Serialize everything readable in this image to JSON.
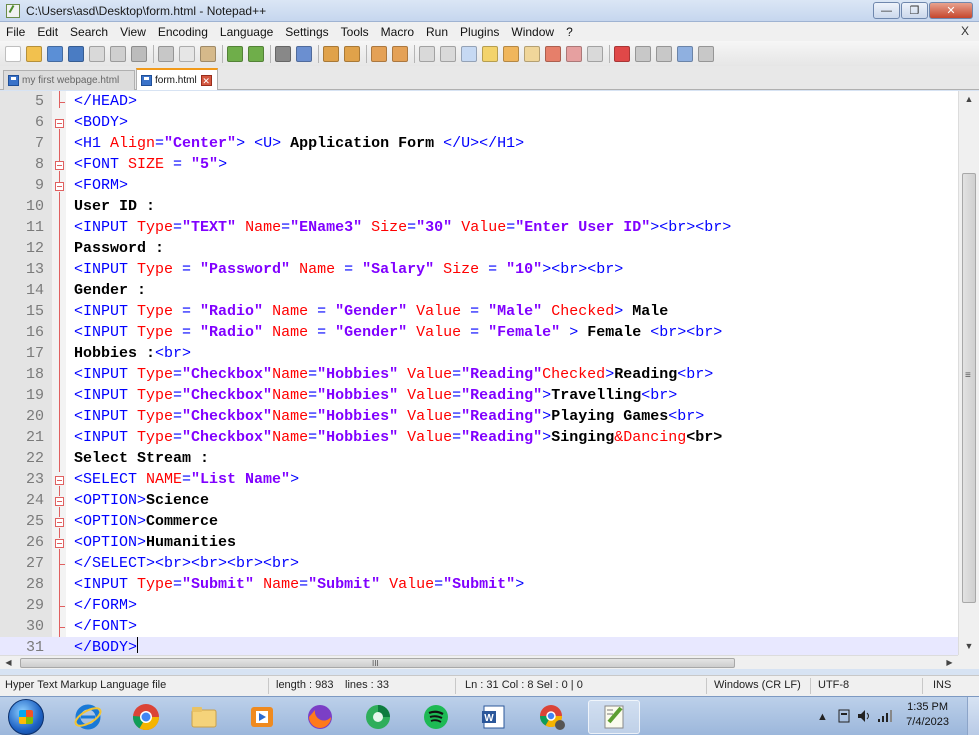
{
  "window": {
    "title": "C:\\Users\\asd\\Desktop\\form.html - Notepad++",
    "minimize": "—",
    "maximize": "❐",
    "close": "✕"
  },
  "menu": {
    "items": [
      "File",
      "Edit",
      "Search",
      "View",
      "Encoding",
      "Language",
      "Settings",
      "Tools",
      "Macro",
      "Run",
      "Plugins",
      "Window",
      "?"
    ],
    "close": "X"
  },
  "toolbar": {
    "icons": [
      "new-file-icon",
      "open-file-icon",
      "save-icon",
      "save-all-icon",
      "close-icon",
      "close-all-icon",
      "print-icon",
      "cut-icon",
      "copy-icon",
      "paste-icon",
      "undo-icon",
      "redo-icon",
      "find-icon",
      "replace-icon",
      "zoom-in-icon",
      "zoom-out-icon",
      "sync-vertical-icon",
      "sync-horizontal-icon",
      "word-wrap-icon",
      "show-all-chars-icon",
      "indent-guide-icon",
      "udl-icon",
      "doc-map-icon",
      "function-list-icon",
      "folder-workspace-icon",
      "monitoring-icon",
      "record-macro-icon",
      "stop-macro-icon",
      "play-macro-icon",
      "run-macro-multiple-icon",
      "save-macro-icon"
    ]
  },
  "tabs": [
    {
      "label": "my first webpage.html",
      "active": false
    },
    {
      "label": "form.html",
      "active": true
    }
  ],
  "editor": {
    "current_line": 31,
    "lines": [
      {
        "n": "5",
        "parts": [
          [
            "tg",
            "</HEAD>"
          ]
        ]
      },
      {
        "n": "6",
        "parts": [
          [
            "tg",
            "<BODY>"
          ]
        ]
      },
      {
        "n": "7",
        "parts": [
          [
            "tg",
            "<H1 "
          ],
          [
            "at",
            "Align"
          ],
          [
            "tg",
            "="
          ],
          [
            "st",
            "\"Center\""
          ],
          [
            "tg",
            "> <U> "
          ],
          [
            "tx",
            "Application Form "
          ],
          [
            "tg",
            "</U></H1>"
          ]
        ]
      },
      {
        "n": "8",
        "parts": [
          [
            "tg",
            "<FONT "
          ],
          [
            "at",
            "SIZE"
          ],
          [
            "tg",
            " = "
          ],
          [
            "st",
            "\"5\""
          ],
          [
            "tg",
            ">"
          ]
        ]
      },
      {
        "n": "9",
        "parts": [
          [
            "tg",
            "<FORM>"
          ]
        ]
      },
      {
        "n": "10",
        "parts": [
          [
            "tx",
            "User ID :"
          ]
        ]
      },
      {
        "n": "11",
        "parts": [
          [
            "tg",
            "<INPUT "
          ],
          [
            "at",
            "Type"
          ],
          [
            "tg",
            "="
          ],
          [
            "st",
            "\"TEXT\""
          ],
          [
            "tg",
            " "
          ],
          [
            "at",
            "Name"
          ],
          [
            "tg",
            "="
          ],
          [
            "st",
            "\"EName3\""
          ],
          [
            "tg",
            " "
          ],
          [
            "at",
            "Size"
          ],
          [
            "tg",
            "="
          ],
          [
            "st",
            "\"30\""
          ],
          [
            "tg",
            " "
          ],
          [
            "at",
            "Value"
          ],
          [
            "tg",
            "="
          ],
          [
            "st",
            "\"Enter User ID\""
          ],
          [
            "tg",
            "><br><br>"
          ]
        ]
      },
      {
        "n": "12",
        "parts": [
          [
            "tx",
            "Password :"
          ]
        ]
      },
      {
        "n": "13",
        "parts": [
          [
            "tg",
            "<INPUT "
          ],
          [
            "at",
            "Type"
          ],
          [
            "tg",
            " = "
          ],
          [
            "st",
            "\"Password\""
          ],
          [
            "tg",
            " "
          ],
          [
            "at",
            "Name"
          ],
          [
            "tg",
            " = "
          ],
          [
            "st",
            "\"Salary\""
          ],
          [
            "tg",
            " "
          ],
          [
            "at",
            "Size"
          ],
          [
            "tg",
            " = "
          ],
          [
            "st",
            "\"10\""
          ],
          [
            "tg",
            "><br><br>"
          ]
        ]
      },
      {
        "n": "14",
        "parts": [
          [
            "tx",
            "Gender :"
          ]
        ]
      },
      {
        "n": "15",
        "parts": [
          [
            "tg",
            "<INPUT "
          ],
          [
            "at",
            "Type"
          ],
          [
            "tg",
            " = "
          ],
          [
            "st",
            "\"Radio\""
          ],
          [
            "tg",
            " "
          ],
          [
            "at",
            "Name"
          ],
          [
            "tg",
            " = "
          ],
          [
            "st",
            "\"Gender\""
          ],
          [
            "tg",
            " "
          ],
          [
            "at",
            "Value"
          ],
          [
            "tg",
            " = "
          ],
          [
            "st",
            "\"Male\""
          ],
          [
            "tg",
            " "
          ],
          [
            "at",
            "Checked"
          ],
          [
            "tg",
            "> "
          ],
          [
            "tx",
            "Male"
          ]
        ]
      },
      {
        "n": "16",
        "parts": [
          [
            "tg",
            "<INPUT "
          ],
          [
            "at",
            "Type"
          ],
          [
            "tg",
            " = "
          ],
          [
            "st",
            "\"Radio\""
          ],
          [
            "tg",
            " "
          ],
          [
            "at",
            "Name"
          ],
          [
            "tg",
            " = "
          ],
          [
            "st",
            "\"Gender\""
          ],
          [
            "tg",
            " "
          ],
          [
            "at",
            "Value"
          ],
          [
            "tg",
            " = "
          ],
          [
            "st",
            "\"Female\""
          ],
          [
            "tg",
            " > "
          ],
          [
            "tx",
            "Female "
          ],
          [
            "tg",
            "<br><br>"
          ]
        ]
      },
      {
        "n": "17",
        "parts": [
          [
            "tx",
            "Hobbies :"
          ],
          [
            "tg",
            "<br>"
          ]
        ]
      },
      {
        "n": "18",
        "parts": [
          [
            "tg",
            "<INPUT "
          ],
          [
            "at",
            "Type"
          ],
          [
            "tg",
            "="
          ],
          [
            "st",
            "\"Checkbox\""
          ],
          [
            "at",
            "Name"
          ],
          [
            "tg",
            "="
          ],
          [
            "st",
            "\"Hobbies\""
          ],
          [
            "tg",
            " "
          ],
          [
            "at",
            "Value"
          ],
          [
            "tg",
            "="
          ],
          [
            "st",
            "\"Reading\""
          ],
          [
            "at",
            "Checked"
          ],
          [
            "tg",
            ">"
          ],
          [
            "tx",
            "Reading"
          ],
          [
            "tg",
            "<br>"
          ]
        ]
      },
      {
        "n": "19",
        "parts": [
          [
            "tg",
            "<INPUT "
          ],
          [
            "at",
            "Type"
          ],
          [
            "tg",
            "="
          ],
          [
            "st",
            "\"Checkbox\""
          ],
          [
            "at",
            "Name"
          ],
          [
            "tg",
            "="
          ],
          [
            "st",
            "\"Hobbies\""
          ],
          [
            "tg",
            " "
          ],
          [
            "at",
            "Value"
          ],
          [
            "tg",
            "="
          ],
          [
            "st",
            "\"Reading\""
          ],
          [
            "tg",
            ">"
          ],
          [
            "tx",
            "Travelling"
          ],
          [
            "tg",
            "<br>"
          ]
        ]
      },
      {
        "n": "20",
        "parts": [
          [
            "tg",
            "<INPUT "
          ],
          [
            "at",
            "Type"
          ],
          [
            "tg",
            "="
          ],
          [
            "st",
            "\"Checkbox\""
          ],
          [
            "at",
            "Name"
          ],
          [
            "tg",
            "="
          ],
          [
            "st",
            "\"Hobbies\""
          ],
          [
            "tg",
            " "
          ],
          [
            "at",
            "Value"
          ],
          [
            "tg",
            "="
          ],
          [
            "st",
            "\"Reading\""
          ],
          [
            "tg",
            ">"
          ],
          [
            "tx",
            "Playing Games"
          ],
          [
            "tg",
            "<br>"
          ]
        ]
      },
      {
        "n": "21",
        "parts": [
          [
            "tg",
            "<INPUT "
          ],
          [
            "at",
            "Type"
          ],
          [
            "tg",
            "="
          ],
          [
            "st",
            "\"Checkbox\""
          ],
          [
            "at",
            "Name"
          ],
          [
            "tg",
            "="
          ],
          [
            "st",
            "\"Hobbies\""
          ],
          [
            "tg",
            " "
          ],
          [
            "at",
            "Value"
          ],
          [
            "tg",
            "="
          ],
          [
            "st",
            "\"Reading\""
          ],
          [
            "tg",
            ">"
          ],
          [
            "tx",
            "Singing"
          ],
          [
            "en",
            "&Dancing"
          ],
          [
            "tx",
            "<br>"
          ]
        ]
      },
      {
        "n": "22",
        "parts": [
          [
            "tx",
            "Select Stream :"
          ]
        ]
      },
      {
        "n": "23",
        "parts": [
          [
            "tg",
            "<SELECT "
          ],
          [
            "at",
            "NAME"
          ],
          [
            "tg",
            "="
          ],
          [
            "st",
            "\"List Name\""
          ],
          [
            "tg",
            ">"
          ]
        ]
      },
      {
        "n": "24",
        "parts": [
          [
            "tg",
            "<OPTION>"
          ],
          [
            "tx",
            "Science"
          ]
        ]
      },
      {
        "n": "25",
        "parts": [
          [
            "tg",
            "<OPTION>"
          ],
          [
            "tx",
            "Commerce"
          ]
        ]
      },
      {
        "n": "26",
        "parts": [
          [
            "tg",
            "<OPTION>"
          ],
          [
            "tx",
            "Humanities"
          ]
        ]
      },
      {
        "n": "27",
        "parts": [
          [
            "tg",
            "</SELECT><br><br><br><br>"
          ]
        ]
      },
      {
        "n": "28",
        "parts": [
          [
            "tg",
            "<INPUT "
          ],
          [
            "at",
            "Type"
          ],
          [
            "tg",
            "="
          ],
          [
            "st",
            "\"Submit\""
          ],
          [
            "tg",
            " "
          ],
          [
            "at",
            "Name"
          ],
          [
            "tg",
            "="
          ],
          [
            "st",
            "\"Submit\""
          ],
          [
            "tg",
            " "
          ],
          [
            "at",
            "Value"
          ],
          [
            "tg",
            "="
          ],
          [
            "st",
            "\"Submit\""
          ],
          [
            "tg",
            ">"
          ]
        ]
      },
      {
        "n": "29",
        "parts": [
          [
            "tg",
            "</FORM>"
          ]
        ]
      },
      {
        "n": "30",
        "parts": [
          [
            "tg",
            "</FONT>"
          ]
        ]
      },
      {
        "n": "31",
        "parts": [
          [
            "tg",
            "</BODY>"
          ]
        ]
      }
    ]
  },
  "scrollbar": {
    "h_grip": "III",
    "up": "▲",
    "down": "▼",
    "left": "◀",
    "right": "▶",
    "v_grip": "≡"
  },
  "status": {
    "file_type": "Hyper Text Markup Language file",
    "length": "length : 983",
    "lines": "lines : 33",
    "position": "Ln : 31    Col : 8    Sel : 0 | 0",
    "eol": "Windows (CR LF)",
    "encoding": "UTF-8",
    "mode": "INS"
  },
  "taskbar": {
    "apps": [
      "internet-explorer-icon",
      "chrome-icon",
      "file-explorer-icon",
      "media-player-icon",
      "firefox-icon",
      "browser-icon",
      "spotify-icon",
      "word-icon",
      "chrome-user-icon",
      "notepad-plus-plus-icon"
    ],
    "tray": {
      "arrow": "▲",
      "time": "1:35 PM",
      "date": "7/4/2023"
    }
  }
}
